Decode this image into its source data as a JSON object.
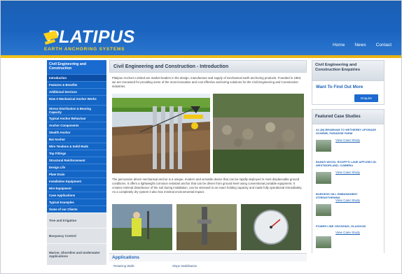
{
  "brand": {
    "logo_text": "PLATIPUS",
    "tagline": "EARTH ANCHORING SYSTEMS",
    "brand_blue": "#1a64c0",
    "accent_gold": "#f0c21a"
  },
  "topnav": [
    "Home",
    "News",
    "Contact"
  ],
  "sidebar": {
    "header": "Civil Engineering and Construction",
    "items": [
      "Introduction",
      "Features & Benefits",
      "Additional Services",
      "How A Mechanical Anchor Works",
      "Stress Distribution & Bearing Capacity",
      "Typical Anchor Behaviour",
      "Anchor Components",
      "Stealth Anchor",
      "Bat Anchor",
      "Wire Tendons & Solid Rods",
      "Top Fittings",
      "Structural Reinforcement",
      "Design Life",
      "Plate Drain",
      "Installation Equipment",
      "Hire Equipment",
      "Case Applications",
      "Typical Examples",
      "Some of our Clients"
    ],
    "gray_items": [
      "Tree and Irrigation",
      "Buoyancy Control",
      "Marine, Shoreline and Underwater Applications"
    ]
  },
  "main": {
    "title": "Civil Engineering and Construction - Introduction",
    "intro": "Platipus Anchors Limited are market leaders in the design, manufacture and supply of mechanical earth anchoring products. Founded in 1983, we are renowned for providing some of the most innovative and cost effective anchoring solutions for the Civil Engineering and Construction industries.",
    "description": "The percussion driven mechanical anchor is a unique, modern and versatile device that can be rapidly deployed in most displaceable ground conditions. It offers a lightweight corrosion resistant anchor that can be driven from ground level using conventional portable equipment. It creates minimal disturbance of the soil during installation, can be stressed to an exact holding capacity and made fully operational immediately. As a completely dry system it also has minimal environmental impact.",
    "applications_title": "Applications",
    "applications": [
      "Retaining Walls",
      "Slope Stabilisation"
    ]
  },
  "right": {
    "enquiries_title": "Civil Engineering and Construction Enquiries",
    "want_more": "Want To Find Out More",
    "enquire_button": "Enquire",
    "featured_title": "Featured Case Studies",
    "case_studies": [
      {
        "title": "A1 (M) BRAMHAM TO WETHERBY UPGRADE SCHEME, PARADISE FARM",
        "link": "View Case Study"
      },
      {
        "title": "BANKS WOOD, ROOPP'S LANE APPLEBY-IN-WESTMORLAND, CUMBRIA",
        "link": "View Case Study"
      },
      {
        "title": "BURGESS HILL EMBANKMENT STRENGTHENING",
        "link": "View Case Study"
      },
      {
        "title": "POWER LINE CROSSING, GLASGOW",
        "link": "View Case Study"
      }
    ]
  }
}
